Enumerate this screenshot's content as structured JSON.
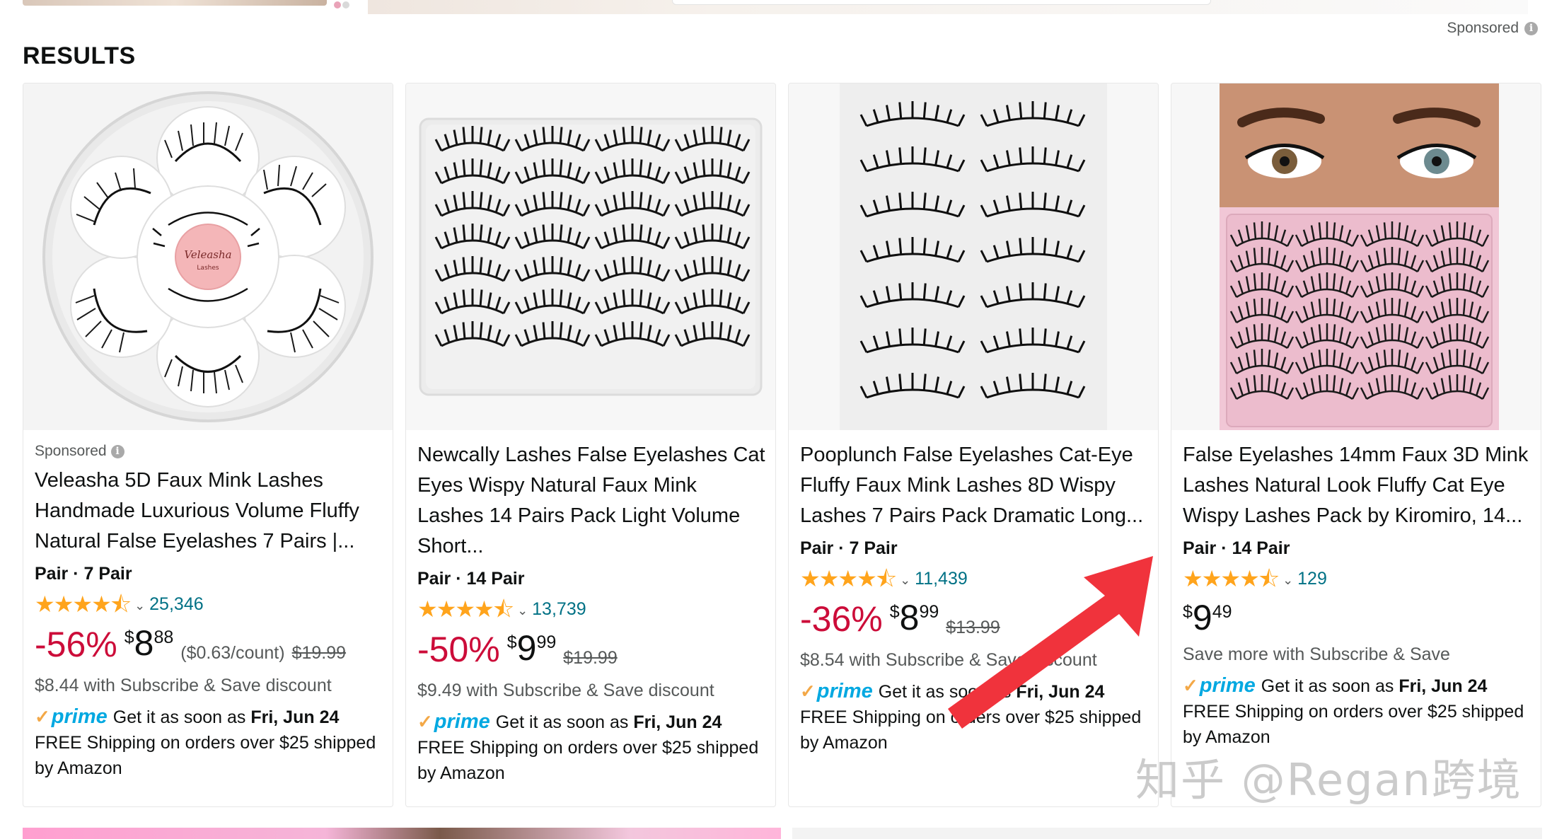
{
  "header": {
    "sponsored_label": "Sponsored",
    "results_title": "RESULTS"
  },
  "products": [
    {
      "sponsored": "Sponsored",
      "title": "Veleasha 5D Faux Mink Lashes Handmade Luxurious Volume Fluffy Natural False Eyelashes 7 Pairs |...",
      "brand_on_image": "Veleasha",
      "brand_on_image_sub": "Lashes",
      "variant": "Pair · 7 Pair",
      "rating": 4.5,
      "rating_count": "25,346",
      "discount": "-56%",
      "price_symbol": "$",
      "price_whole": "8",
      "price_fraction": "88",
      "unit_price": "($0.63/count)",
      "list_price": "$19.99",
      "subscribe": "$8.44 with Subscribe & Save discount",
      "prime_label": "prime",
      "delivery": "Get it as soon as",
      "delivery_date": "Fri, Jun 24",
      "shipping": "FREE Shipping on orders over $25 shipped by Amazon"
    },
    {
      "title": "Newcally Lashes False Eyelashes Cat Eyes Wispy Natural Faux Mink Lashes 14 Pairs Pack Light Volume Short...",
      "variant": "Pair · 14 Pair",
      "rating": 4.5,
      "rating_count": "13,739",
      "discount": "-50%",
      "price_symbol": "$",
      "price_whole": "9",
      "price_fraction": "99",
      "list_price": "$19.99",
      "subscribe": "$9.49 with Subscribe & Save discount",
      "prime_label": "prime",
      "delivery": "Get it as soon as",
      "delivery_date": "Fri, Jun 24",
      "shipping": "FREE Shipping on orders over $25 shipped by Amazon"
    },
    {
      "title": "Pooplunch False Eyelashes Cat-Eye Fluffy Faux Mink Lashes 8D Wispy Lashes 7 Pairs Pack Dramatic Long...",
      "variant": "Pair · 7 Pair",
      "rating": 4.5,
      "rating_count": "11,439",
      "discount": "-36%",
      "price_symbol": "$",
      "price_whole": "8",
      "price_fraction": "99",
      "list_price": "$13.99",
      "subscribe": "$8.54 with Subscribe & Save discount",
      "prime_label": "prime",
      "delivery": "Get it as soon as",
      "delivery_date": "Fri, Jun 24",
      "shipping": "FREE Shipping on orders over $25 shipped by Amazon"
    },
    {
      "title": "False Eyelashes 14mm Faux 3D Mink Lashes Natural Look Fluffy Cat Eye Wispy Lashes Pack by Kiromiro, 14...",
      "variant": "Pair · 14 Pair",
      "rating": 4.5,
      "rating_count": "129",
      "price_symbol": "$",
      "price_whole": "9",
      "price_fraction": "49",
      "subscribe": "Save more with Subscribe & Save",
      "prime_label": "prime",
      "delivery": "Get it as soon as",
      "delivery_date": "Fri, Jun 24",
      "shipping": "FREE Shipping on orders over $25 shipped by Amazon"
    }
  ],
  "watermark": "知乎 @Regan跨境",
  "colors": {
    "price_red": "#cc0c39",
    "link_teal": "#007185",
    "star": "#ffa41c",
    "prime_blue": "#00a8e1",
    "annotation_arrow": "#f0333c"
  }
}
